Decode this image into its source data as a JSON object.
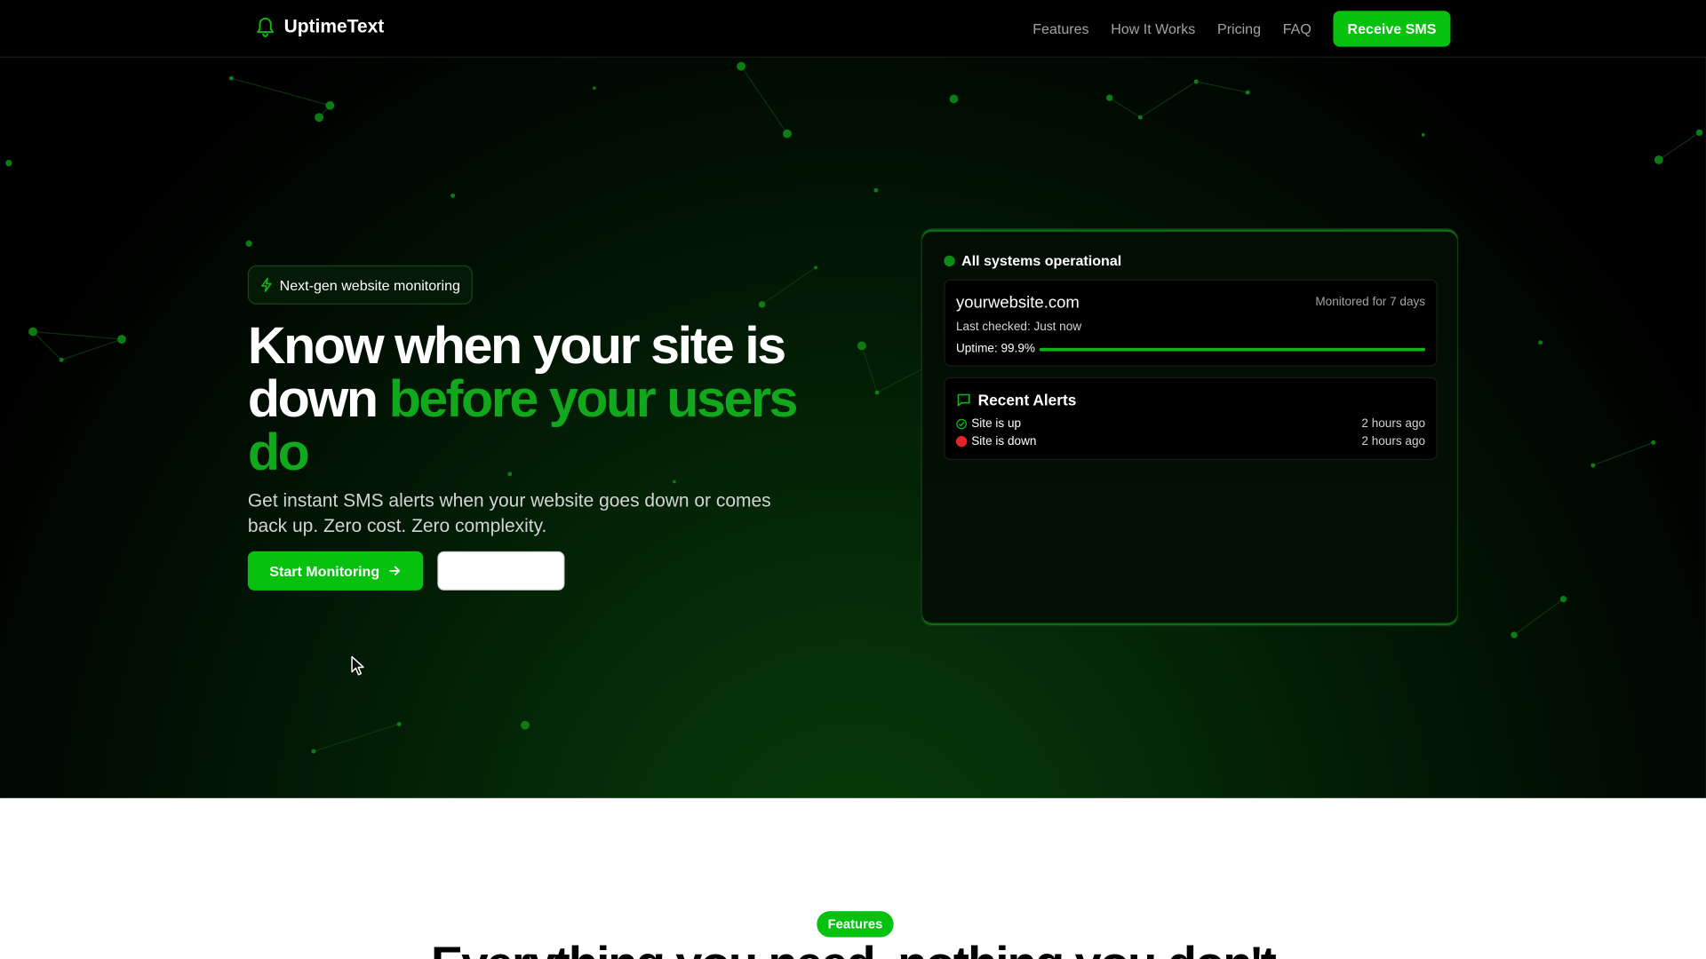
{
  "brand": {
    "name": "UptimeText",
    "icon": "bell-icon"
  },
  "nav": {
    "links": [
      "Features",
      "How It Works",
      "Pricing",
      "FAQ"
    ],
    "cta": "Receive SMS"
  },
  "hero": {
    "badge": "Next-gen website monitoring",
    "headline_white": "Know when your site is down ",
    "headline_green": "before your users do",
    "subtitle": "Get instant SMS alerts when your website goes down or comes back up. Zero cost. Zero complexity.",
    "primary_button": "Start Monitoring",
    "secondary_button": ""
  },
  "panel": {
    "status": "All systems operational",
    "site": "yourwebsite.com",
    "monitored": "Monitored for 7 days",
    "last_checked": "Last checked: Just now",
    "uptime_label": "Uptime: 99.9%",
    "uptime_fraction": 0.999,
    "alerts_title": "Recent Alerts",
    "alerts": [
      {
        "text": "Site is up",
        "time": "2 hours ago",
        "status": "up"
      },
      {
        "text": "Site is down",
        "time": "2 hours ago",
        "status": "down"
      }
    ]
  },
  "features": {
    "pill": "Features",
    "heading": "Everything you need, nothing you don't"
  },
  "colors": {
    "accent": "#06c20f",
    "accent_dark": "#11a81c",
    "down": "#e52525"
  }
}
